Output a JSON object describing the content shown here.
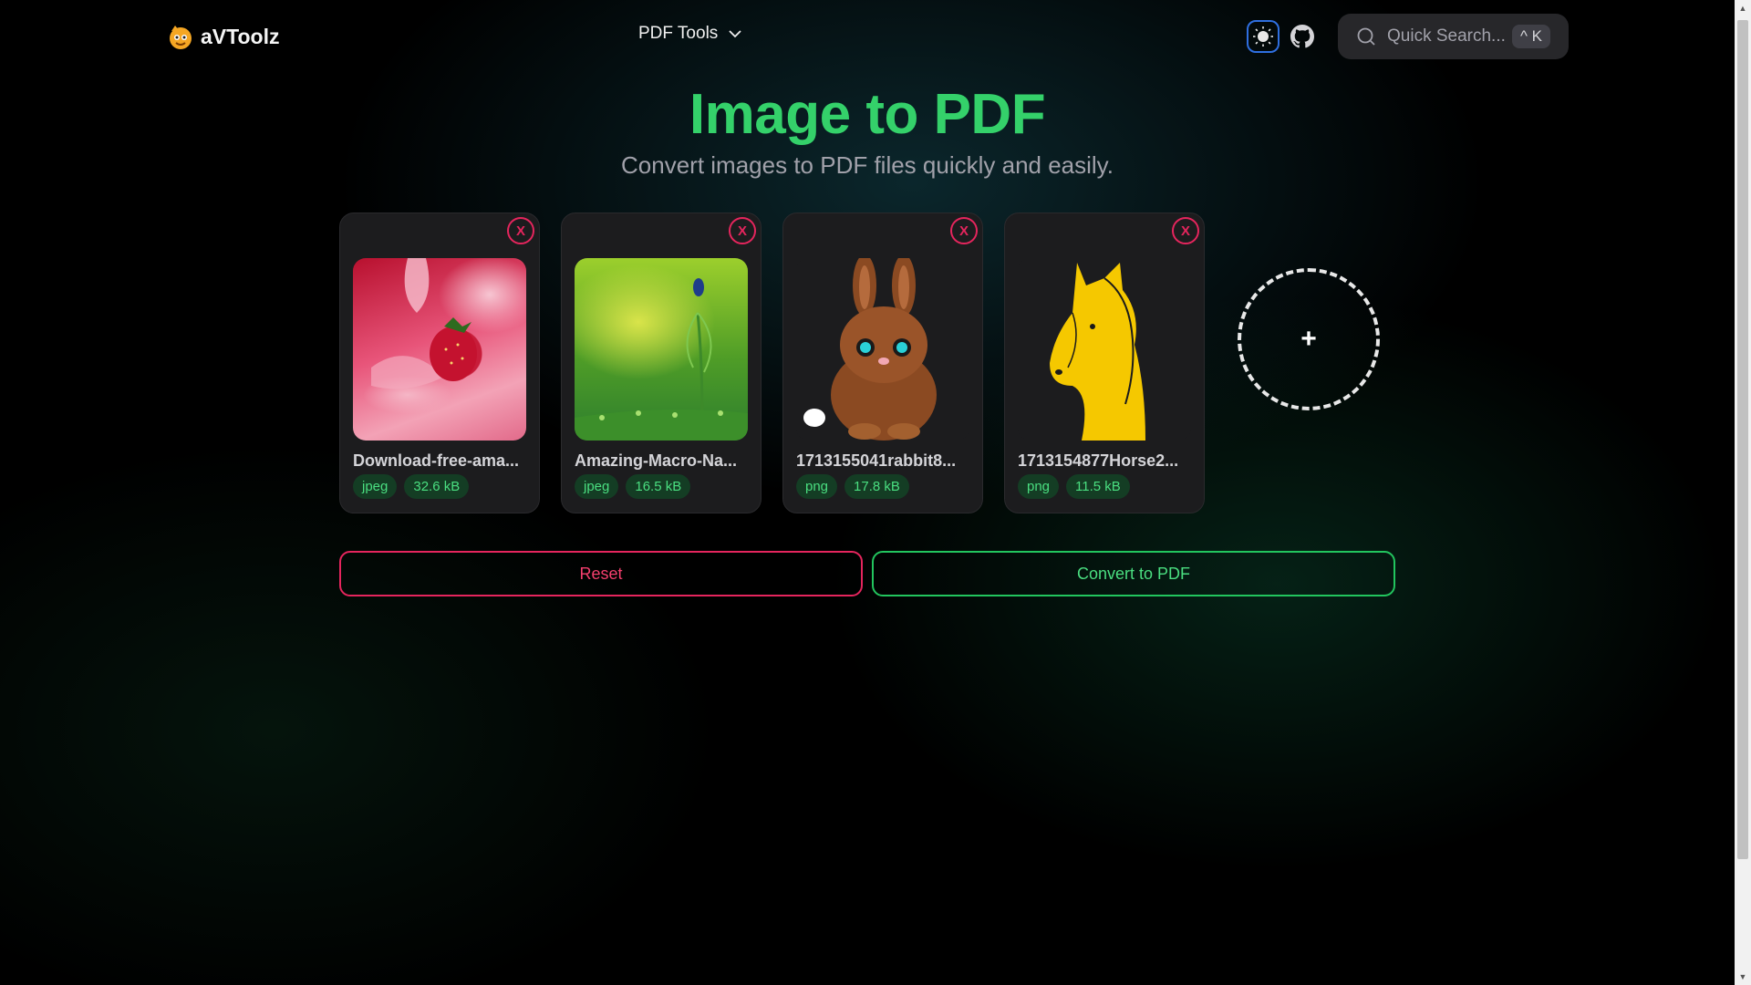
{
  "header": {
    "brand": "aVToolz",
    "nav_label": "PDF Tools",
    "search_placeholder": "Quick Search...",
    "search_shortcut": "^ K"
  },
  "page": {
    "title": "Image to PDF",
    "subtitle": "Convert images to PDF files quickly and easily."
  },
  "files": [
    {
      "name": "Download-free-ama...",
      "type": "jpeg",
      "size": "32.6 kB",
      "remove": "X"
    },
    {
      "name": "Amazing-Macro-Na...",
      "type": "jpeg",
      "size": "16.5 kB",
      "remove": "X"
    },
    {
      "name": "1713155041rabbit8...",
      "type": "png",
      "size": "17.8 kB",
      "remove": "X"
    },
    {
      "name": "1713154877Horse2...",
      "type": "png",
      "size": "11.5 kB",
      "remove": "X"
    }
  ],
  "add_button": "+",
  "actions": {
    "reset": "Reset",
    "convert": "Convert to PDF"
  },
  "colors": {
    "accent_green": "#34d16a",
    "danger_pink": "#e5255d",
    "chip_bg": "#143d24"
  },
  "icons": [
    "logo-icon",
    "chevron-down-icon",
    "sun-icon",
    "github-icon",
    "search-icon"
  ]
}
